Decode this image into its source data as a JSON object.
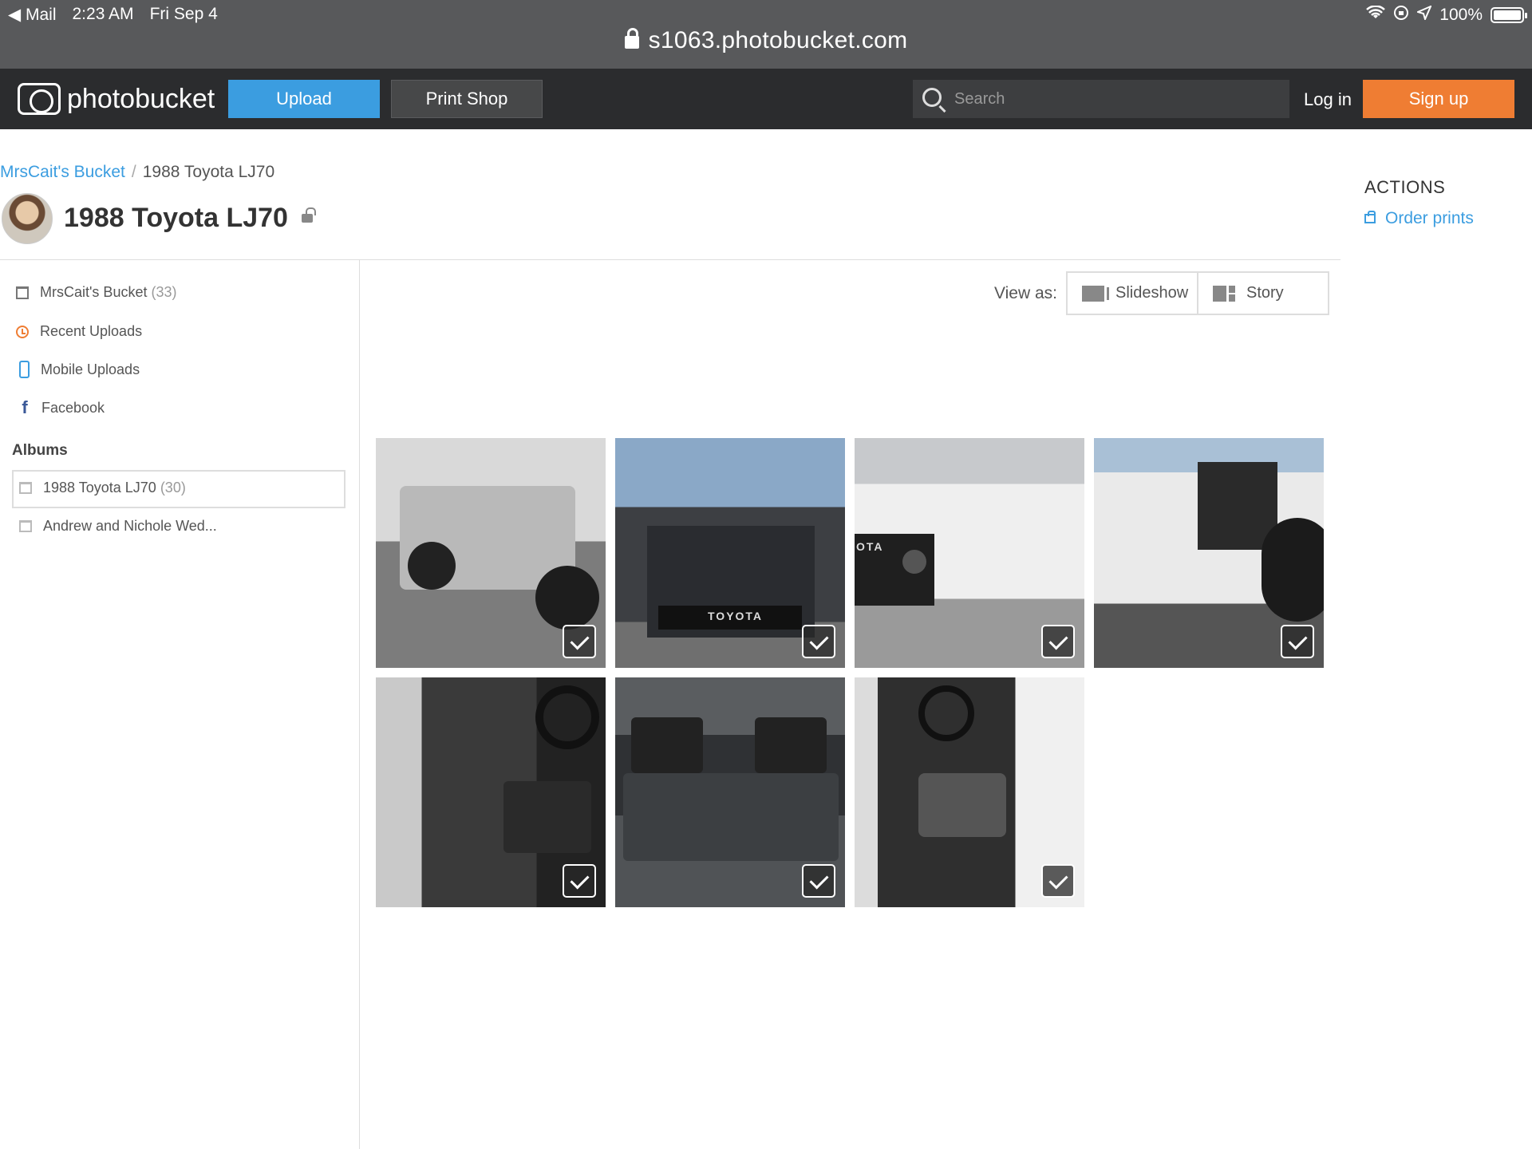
{
  "status_bar": {
    "back_app": "◀ Mail",
    "time": "2:23 AM",
    "date": "Fri Sep 4",
    "battery": "100%",
    "battery_level": 1.0
  },
  "url_bar": {
    "url": "s1063.photobucket.com"
  },
  "nav": {
    "logo_text": "photobucket",
    "upload_label": "Upload",
    "print_shop_label": "Print Shop",
    "search_placeholder": "Search",
    "login_label": "Log in",
    "signup_label": "Sign up"
  },
  "breadcrumb": {
    "root": "MrsCait's Bucket",
    "sep": "/",
    "current": "1988 Toyota LJ70"
  },
  "page_title": "1988 Toyota LJ70",
  "actions": {
    "heading": "ACTIONS",
    "order_prints": "Order prints"
  },
  "sidebar": {
    "items": [
      {
        "label": "MrsCait's Bucket",
        "count": "(33)"
      },
      {
        "label": "Recent Uploads"
      },
      {
        "label": "Mobile Uploads"
      },
      {
        "label": "Facebook"
      }
    ],
    "albums_heading": "Albums",
    "albums": [
      {
        "label": "1988 Toyota LJ70",
        "count": "(30)"
      },
      {
        "label": "Andrew and Nichole Wed..."
      }
    ]
  },
  "view_as": {
    "label": "View as:",
    "slideshow": "Slideshow",
    "story": "Story"
  },
  "photos": {
    "grille_text_2": "TOYOTA",
    "grille_text_3": "OTA"
  },
  "colors": {
    "accent_blue": "#3b9de0",
    "signup_orange": "#ef7d33",
    "nav_bg": "#2b2c2e"
  }
}
